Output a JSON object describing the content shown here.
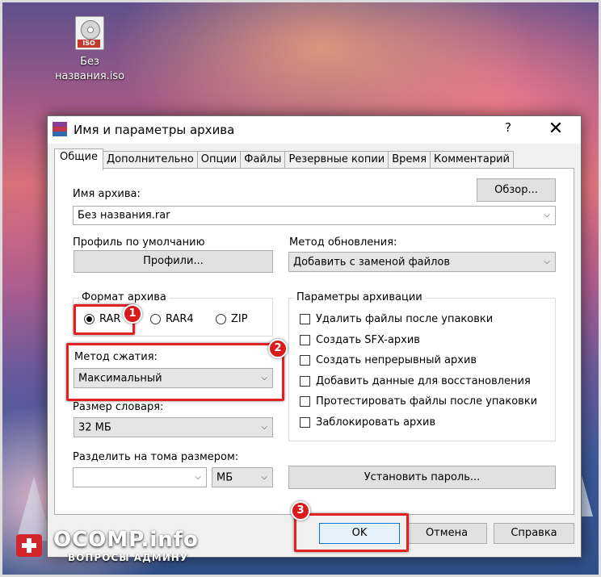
{
  "desktop": {
    "icon_tag": "ISO",
    "icon_label_line1": "Без",
    "icon_label_line2": "названия.iso"
  },
  "dialog": {
    "title": "Имя и параметры архива",
    "help_button": "?",
    "close_button": "✕",
    "tabs": [
      "Общие",
      "Дополнительно",
      "Опции",
      "Файлы",
      "Резервные копии",
      "Время",
      "Комментарий"
    ],
    "active_tab": "Общие",
    "archive_name_label": "Имя архива:",
    "browse_button": "Обзор...",
    "archive_name_value": "Без названия.rar",
    "default_profile_label": "Профиль по умолчанию",
    "profiles_button": "Профили...",
    "update_method_label": "Метод обновления:",
    "update_method_value": "Добавить с заменой файлов",
    "archive_format": {
      "title": "Формат архива",
      "options": [
        "RAR",
        "RAR4",
        "ZIP"
      ],
      "selected": "RAR"
    },
    "compression_method_label": "Метод сжатия:",
    "compression_method_value": "Максимальный",
    "dictionary_size_label": "Размер словаря:",
    "dictionary_size_value": "32 МБ",
    "split_volumes_label": "Разделить на тома размером:",
    "split_volumes_value": "",
    "split_unit_value": "МБ",
    "archiving_options": {
      "title": "Параметры архивации",
      "items": [
        {
          "label": "Удалить файлы после упаковки",
          "checked": false
        },
        {
          "label": "Создать SFX-архив",
          "checked": false
        },
        {
          "label": "Создать непрерывный архив",
          "checked": false
        },
        {
          "label": "Добавить данные для восстановления",
          "checked": false
        },
        {
          "label": "Протестировать файлы после упаковки",
          "checked": false
        },
        {
          "label": "Заблокировать архив",
          "checked": false
        }
      ]
    },
    "set_password_button": "Установить пароль...",
    "ok_button": "OK",
    "cancel_button": "Отмена",
    "help_footer_button": "Справка"
  },
  "annotations": [
    "1",
    "2",
    "3"
  ],
  "annotation_color": "#e32121",
  "watermark": {
    "name": "OCOMP.info",
    "tagline": "ВОПРОСЫ АДМИНУ"
  }
}
